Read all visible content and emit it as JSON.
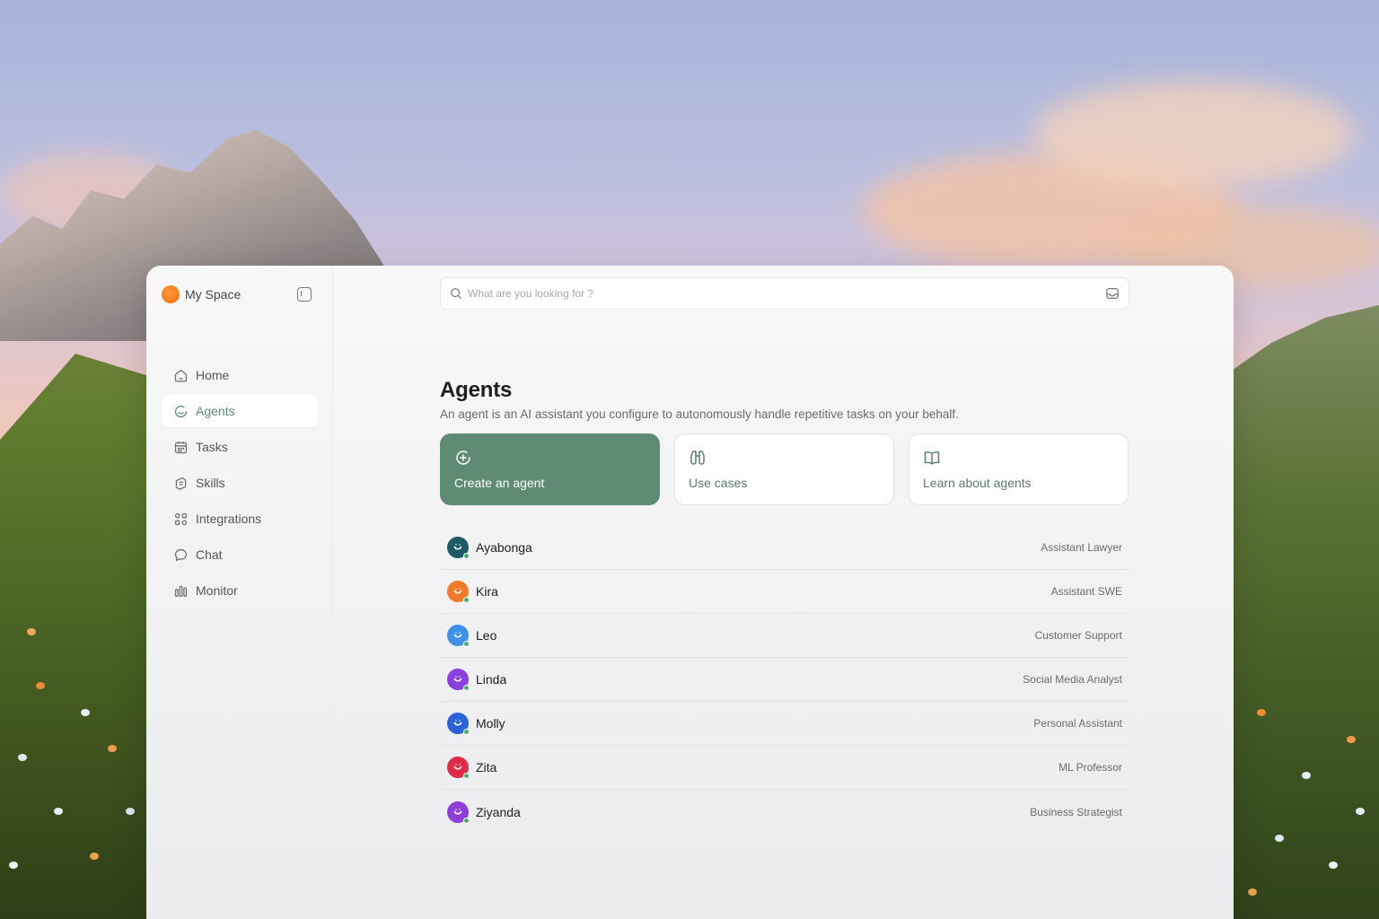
{
  "sidebar": {
    "space_name": "My Space",
    "items": [
      {
        "label": "Home",
        "icon": "home-icon"
      },
      {
        "label": "Agents",
        "icon": "agents-icon",
        "active": true
      },
      {
        "label": "Tasks",
        "icon": "calendar-icon"
      },
      {
        "label": "Skills",
        "icon": "skills-icon"
      },
      {
        "label": "Integrations",
        "icon": "integrations-icon"
      },
      {
        "label": "Chat",
        "icon": "chat-icon"
      },
      {
        "label": "Monitor",
        "icon": "bar-chart-icon"
      }
    ]
  },
  "search": {
    "placeholder": "What are you looking for ?",
    "value": ""
  },
  "page": {
    "title": "Agents",
    "subtitle": "An agent is an AI assistant you configure to autonomously handle repetitive tasks on your behalf."
  },
  "cards": [
    {
      "label": "Create an agent",
      "icon": "plus-circle-icon"
    },
    {
      "label": "Use cases",
      "icon": "binoculars-icon"
    },
    {
      "label": "Learn about agents",
      "icon": "book-icon"
    }
  ],
  "agents": [
    {
      "name": "Ayabonga",
      "role": "Assistant Lawyer",
      "color": "#1e5a63"
    },
    {
      "name": "Kira",
      "role": "Assistant SWE",
      "color": "#f07a2a"
    },
    {
      "name": "Leo",
      "role": "Customer Support",
      "color": "#3f8ee8"
    },
    {
      "name": "Linda",
      "role": "Social Media Analyst",
      "color": "#8a3fe0"
    },
    {
      "name": "Molly",
      "role": "Personal Assistant",
      "color": "#2a63d8"
    },
    {
      "name": "Zita",
      "role": "ML Professor",
      "color": "#e02a4a"
    },
    {
      "name": "Ziyanda",
      "role": "Business Strategist",
      "color": "#8e3fd8"
    }
  ],
  "colors": {
    "accent": "#5f8a73",
    "online": "#3fb36a"
  }
}
